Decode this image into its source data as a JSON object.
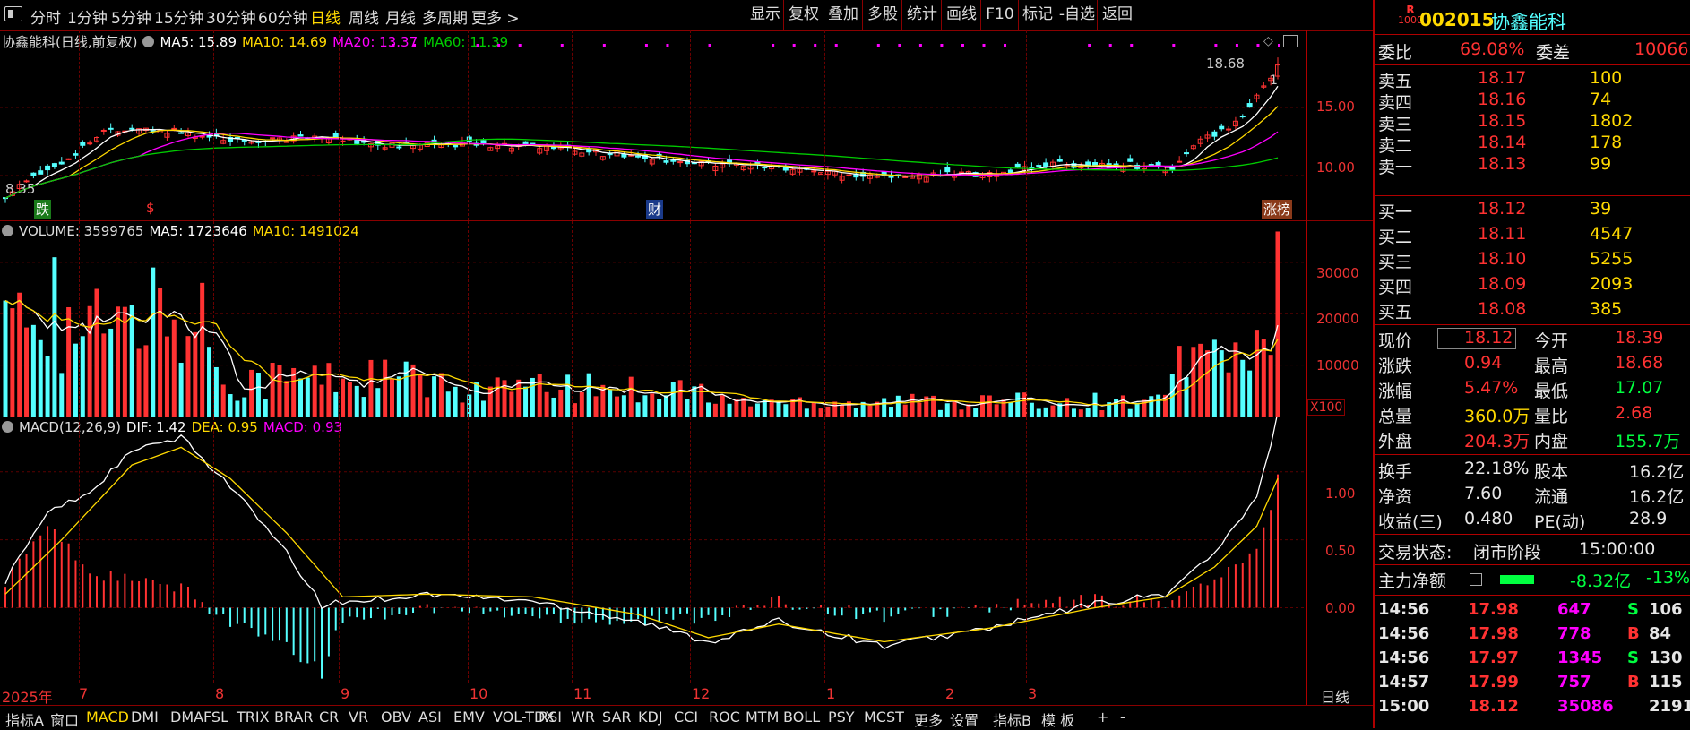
{
  "colors": {
    "up": "#ff3232",
    "down": "#54ffff",
    "ma5": "#ffffff",
    "ma10": "#ffd900",
    "ma20": "#ff00ff",
    "ma60": "#00cc00",
    "dea": "#ffd900",
    "dif": "#ffffff"
  },
  "menu_icon": "menu-icon",
  "top_tabs": [
    "分时",
    "1分钟",
    "5分钟",
    "15分钟",
    "30分钟",
    "60分钟",
    "日线",
    "周线",
    "月线",
    "多周期",
    "更多 >"
  ],
  "top_active": "日线",
  "top_right": [
    "显示",
    "复权",
    "叠加",
    "多股",
    "统计",
    "画线",
    "F10",
    "标记",
    "-自选",
    "返回"
  ],
  "price_panel": {
    "title": "协鑫能科(日线,前复权)",
    "ma5": "MA5: 15.89",
    "ma10": "MA10: 14.69",
    "ma20": "MA20: 13.37",
    "ma60": "MA60: 11.39",
    "ticks": [
      "15.00",
      "10.00"
    ],
    "label_high": "18.68",
    "label_low": "8.35",
    "label_one": "1",
    "badge_die": "跌",
    "badge_s": "$",
    "badge_cai": "财",
    "badge_zhangbang": "涨榜"
  },
  "vol_panel": {
    "title": "VOLUME: 3599765",
    "ma5": "MA5: 1723646",
    "ma10": "MA10: 1491024",
    "ticks": [
      "30000",
      "20000",
      "10000"
    ],
    "unit": "X100"
  },
  "macd_panel": {
    "title": "MACD(12,26,9)",
    "dif": "DIF: 1.42",
    "dea": "DEA: 0.95",
    "macd": "MACD: 0.93",
    "ticks": [
      "1.00",
      "0.50",
      "0.00"
    ]
  },
  "date_axis": {
    "labels": [
      "2025年",
      "7",
      "8",
      "9",
      "10",
      "11",
      "12",
      "1",
      "2",
      "3"
    ],
    "period": "日线"
  },
  "bottom_tabs": [
    "指标A",
    "窗口",
    "MACD",
    "DMI",
    "DMA",
    "FSL",
    "TRIX",
    "BRAR",
    "CR",
    "VR",
    "OBV",
    "ASI",
    "EMV",
    "VOL-TDX",
    "RSI",
    "WR",
    "SAR",
    "KDJ",
    "CCI",
    "ROC",
    "MTM",
    "BOLL",
    "PSY",
    "MCST",
    "更多",
    "设置",
    "指标B",
    "模 板",
    "+",
    "-"
  ],
  "bottom_active": "MACD",
  "quote": {
    "badge_r": "R",
    "badge_num": "1000",
    "code": "002015",
    "name": "协鑫能科",
    "weibi_label": "委比",
    "weibi": "69.08%",
    "weicha_label": "委差",
    "weicha": "10066",
    "asks": [
      {
        "label": "卖五",
        "price": "18.17",
        "vol": "100"
      },
      {
        "label": "卖四",
        "price": "18.16",
        "vol": "74"
      },
      {
        "label": "卖三",
        "price": "18.15",
        "vol": "1802"
      },
      {
        "label": "卖二",
        "price": "18.14",
        "vol": "178"
      },
      {
        "label": "卖一",
        "price": "18.13",
        "vol": "99"
      }
    ],
    "bids": [
      {
        "label": "买一",
        "price": "18.12",
        "vol": "39"
      },
      {
        "label": "买二",
        "price": "18.11",
        "vol": "4547"
      },
      {
        "label": "买三",
        "price": "18.10",
        "vol": "5255"
      },
      {
        "label": "买四",
        "price": "18.09",
        "vol": "2093"
      },
      {
        "label": "买五",
        "price": "18.08",
        "vol": "385"
      }
    ],
    "stats": [
      {
        "l1": "现价",
        "v1": "18.12",
        "l2": "今开",
        "v2": "18.39"
      },
      {
        "l1": "涨跌",
        "v1": "0.94",
        "l2": "最高",
        "v2": "18.68"
      },
      {
        "l1": "涨幅",
        "v1": "5.47%",
        "l2": "最低",
        "v2": "17.07"
      },
      {
        "l1": "总量",
        "v1": "360.0万",
        "l2": "量比",
        "v2": "2.68"
      },
      {
        "l1": "外盘",
        "v1": "204.3万",
        "l2": "内盘",
        "v2": "155.7万"
      }
    ],
    "stats2": [
      {
        "l1": "换手",
        "v1": "22.18%",
        "l2": "股本",
        "v2": "16.2亿"
      },
      {
        "l1": "净资",
        "v1": "7.60",
        "l2": "流通",
        "v2": "16.2亿"
      },
      {
        "l1": "收益(三)",
        "v1": "0.480",
        "l2": "PE(动)",
        "v2": "28.9"
      }
    ],
    "status_label": "交易状态:",
    "status_value": "闭市阶段",
    "status_time": "15:00:00",
    "main_flow_label": "主力净额",
    "main_flow_value": "-8.32亿",
    "main_flow_pct": "-13%",
    "ticks": [
      {
        "time": "14:56",
        "price": "17.98",
        "vol": "647",
        "side": "S",
        "num": "106"
      },
      {
        "time": "14:56",
        "price": "17.98",
        "vol": "778",
        "side": "B",
        "num": "84"
      },
      {
        "time": "14:56",
        "price": "17.97",
        "vol": "1345",
        "side": "S",
        "num": "130"
      },
      {
        "time": "14:57",
        "price": "17.99",
        "vol": "757",
        "side": "B",
        "num": "115"
      },
      {
        "time": "15:00",
        "price": "18.12",
        "vol": "35086",
        "side": "",
        "num": "2191"
      }
    ]
  },
  "chart_data": [
    {
      "type": "candlestick",
      "title": "协鑫能科(日线,前复权)",
      "ylim": [
        7.5,
        20
      ],
      "ma_series": [
        "MA5",
        "MA10",
        "MA20",
        "MA60"
      ],
      "last_close": 18.12,
      "high": 18.68,
      "low_marker": 8.35
    },
    {
      "type": "bar",
      "title": "VOLUME",
      "ylim": [
        0,
        38000
      ],
      "last_volume": 36000,
      "unit": "X100"
    },
    {
      "type": "bar",
      "title": "MACD(12,26,9)",
      "ylim": [
        -0.55,
        1.4
      ],
      "dif_last": 1.42,
      "dea_last": 0.95,
      "macd_last": 0.93
    }
  ]
}
